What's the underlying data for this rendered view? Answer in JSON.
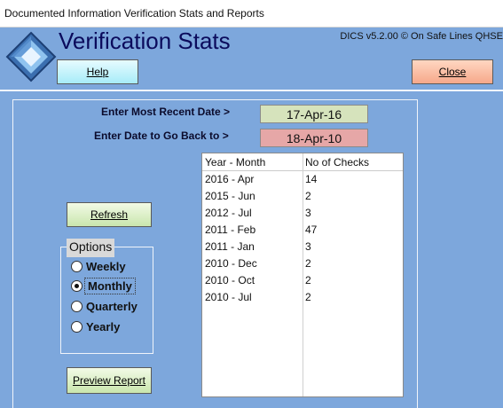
{
  "window": {
    "title": "Documented Information Verification Stats and Reports"
  },
  "header": {
    "title": "Verification Stats",
    "version": "DICS v5.2.00 © On Safe Lines QHSE",
    "help_label": "Help",
    "close_label": "Close",
    "logo_icon": "diamond-logo-icon"
  },
  "dates": {
    "recent_label": "Enter Most Recent Date >",
    "recent_value": "17-Apr-16",
    "back_label": "Enter Date to Go Back to >",
    "back_value": "18-Apr-10"
  },
  "buttons": {
    "refresh_label": "Refresh",
    "preview_label": "Preview Report"
  },
  "options": {
    "legend": "Options",
    "items": [
      {
        "label": "Weekly",
        "checked": false
      },
      {
        "label": "Monthly",
        "checked": true
      },
      {
        "label": "Quarterly",
        "checked": false
      },
      {
        "label": "Yearly",
        "checked": false
      }
    ]
  },
  "table": {
    "headers": [
      "Year - Month",
      "No of Checks"
    ],
    "rows": [
      [
        "2016 - Apr",
        "14"
      ],
      [
        "2015 - Jun",
        "2"
      ],
      [
        "2012 - Jul",
        "3"
      ],
      [
        "2011 - Feb",
        "47"
      ],
      [
        "2011 - Jan",
        "3"
      ],
      [
        "2010 - Dec",
        "2"
      ],
      [
        "2010 - Oct",
        "2"
      ],
      [
        "2010 - Jul",
        "2"
      ]
    ]
  },
  "colors": {
    "background": "#7da7dc",
    "title_text": "#0b0b5c",
    "recent_date_bg": "#d6e3bc",
    "back_date_bg": "#e6a7a7",
    "help_button": "#a7ecf8",
    "close_button": "#f6a88a",
    "green_button": "#c9e6ad"
  }
}
